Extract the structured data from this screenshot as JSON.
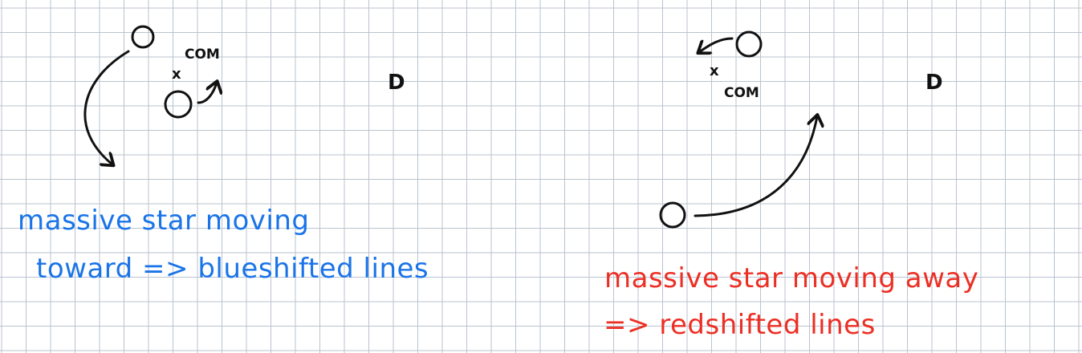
{
  "panels": [
    {
      "com_marker": "x",
      "com_label": "COM",
      "observer_symbol": "D",
      "caption_line1": "massive star moving",
      "caption_line2": "toward => blueshifted lines",
      "caption_color": "#1a74e8"
    },
    {
      "com_marker": "x",
      "com_label": "COM",
      "observer_symbol": "D",
      "caption_line1": "massive star moving away",
      "caption_line2": "=> redshifted lines",
      "caption_color": "#ec2f24"
    }
  ],
  "colors": {
    "grid": "#b9c3cf",
    "ink": "#111111"
  }
}
